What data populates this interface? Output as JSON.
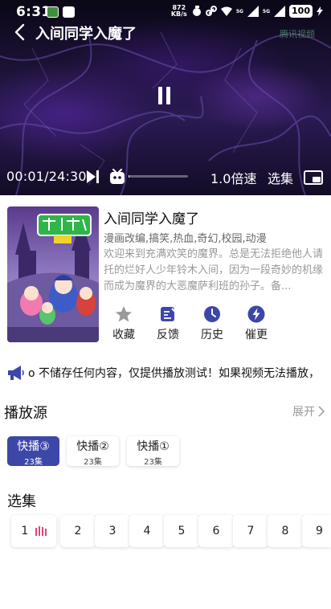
{
  "status_bar": {
    "time": "6:31",
    "net_speed_value": "872",
    "net_speed_unit": "KB/s",
    "battery": "100",
    "signal_label_1": "5G",
    "signal_label_2": "5G"
  },
  "player": {
    "title": "入间同学入魔了",
    "watermark": "腾讯视频",
    "current_time": "00:01",
    "duration": "24:30",
    "time_display": "00:01/24:30",
    "progress_fraction": 0.01,
    "speed_label": "1.0倍速",
    "episodes_label": "选集"
  },
  "anime": {
    "title": "入间同学入魔了",
    "tags": "漫画改编,搞笑,热血,奇幻,校园,动漫",
    "description": "欢迎来到充满欢笑的魔界。总是无法拒绝他人请托的烂好人少年铃木入间，因为一段奇妙的机缘而成为魔界的大恶魔萨利班的孙子。备..."
  },
  "actions": [
    {
      "label": "收藏",
      "icon": "star-icon",
      "color": "#9a9a9a"
    },
    {
      "label": "反馈",
      "icon": "feedback-icon",
      "color": "#3d47a8"
    },
    {
      "label": "历史",
      "icon": "clock-icon",
      "color": "#3d47a8"
    },
    {
      "label": "催更",
      "icon": "lightning-icon",
      "color": "#3d47a8"
    }
  ],
  "notice": {
    "text": "o 不储存任何内容，仅提供播放测试！如果视频无法播放，"
  },
  "sources": {
    "title": "播放源",
    "expand_label": "展开",
    "items": [
      {
        "name": "快播③",
        "count": "23集",
        "active": true
      },
      {
        "name": "快播②",
        "count": "23集",
        "active": false
      },
      {
        "name": "快播①",
        "count": "23集",
        "active": false
      }
    ]
  },
  "episodes": {
    "title": "选集",
    "items": [
      "1",
      "2",
      "3",
      "4",
      "5",
      "6",
      "7",
      "8",
      "9"
    ],
    "playing_index": 0
  },
  "colors": {
    "accent": "#3d47a8",
    "playing_indicator": "#e0457b",
    "muted_text": "#999999"
  }
}
